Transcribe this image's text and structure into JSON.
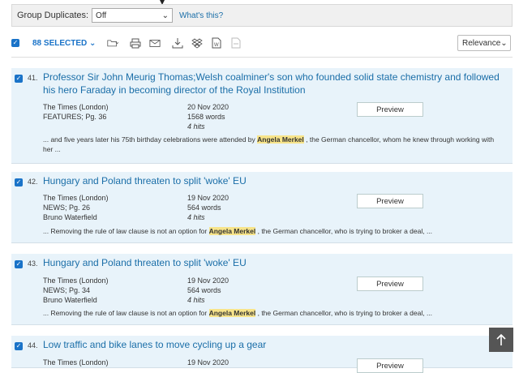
{
  "group": {
    "label": "Group Duplicates:",
    "value": "Off",
    "link": "What's this?"
  },
  "toolbar": {
    "selected": "88 SELECTED",
    "sort": "Relevance"
  },
  "results": [
    {
      "num": "41.",
      "title": "Professor Sir John Meurig Thomas;Welsh coalminer's son who founded solid state chemistry and followed his hero Faraday in becoming director of the Royal Institution",
      "source": "The Times (London)",
      "section": "FEATURES; Pg. 36",
      "author": "",
      "date": "20 Nov 2020",
      "words": "1568 words",
      "hits": "4 hits",
      "preview": "Preview",
      "snippet_pre": "... and five years later his 75th birthday celebrations were attended by ",
      "snippet_hl": "Angela Merkel",
      "snippet_post": " , the German chancellor, whom he knew through working with her ..."
    },
    {
      "num": "42.",
      "title": "Hungary and Poland threaten to split 'woke' EU",
      "source": "The Times (London)",
      "section": "NEWS; Pg. 26",
      "author": "Bruno Waterfield",
      "date": "19 Nov 2020",
      "words": "564 words",
      "hits": "4 hits",
      "preview": "Preview",
      "snippet_pre": "... Removing the rule of law clause is not an option for ",
      "snippet_hl": "Angela Merkel",
      "snippet_post": " , the German chancellor, who is trying to broker a deal, ..."
    },
    {
      "num": "43.",
      "title": "Hungary and Poland threaten to split 'woke' EU",
      "source": "The Times (London)",
      "section": "NEWS; Pg. 34",
      "author": "Bruno Waterfield",
      "date": "19 Nov 2020",
      "words": "564 words",
      "hits": "4 hits",
      "preview": "Preview",
      "snippet_pre": "... Removing the rule of law clause is not an option for ",
      "snippet_hl": "Angela Merkel",
      "snippet_post": " , the German chancellor, who is trying to broker a deal, ..."
    },
    {
      "num": "44.",
      "title": "Low traffic and bike lanes to move cycling up a gear",
      "source": "The Times (London)",
      "date": "19 Nov 2020",
      "preview": "Preview"
    }
  ],
  "colors": {
    "link": "#1a6ea8",
    "card_bg": "#e8f3fa",
    "highlight": "#f7e48a",
    "checkbox": "#1a73c8"
  },
  "icons": [
    "folder-icon",
    "print-icon",
    "email-icon",
    "download-icon",
    "dropbox-icon",
    "word-doc-icon",
    "pdf-icon",
    "back-to-top-icon"
  ]
}
